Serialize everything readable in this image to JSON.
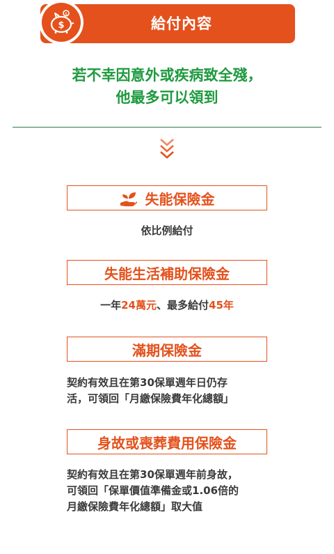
{
  "header": {
    "title": "給付內容",
    "icon": "piggy-bank-icon",
    "color": "#e4511c"
  },
  "headline": {
    "line1": "若不幸因意外或疾病致全殘，",
    "line2": "他最多可以領到",
    "color": "#1f9a3f"
  },
  "sections": [
    {
      "title": "失能保險金",
      "icon": "hand-leaf-icon",
      "desc": "依比例給付"
    },
    {
      "title": "失能生活補助保險金",
      "desc_parts": [
        "一年",
        "24萬元",
        "、最多給付",
        "45年"
      ]
    },
    {
      "title": "滿期保險金",
      "desc_lines": [
        "契約有效且在第30保單週年日仍存",
        "活，可領回「月繳保險費年化總額」"
      ]
    },
    {
      "title": "身故或喪葬費用保險金",
      "desc_lines": [
        "契約有效且在第30保單週年前身故，",
        "可領回「保單價值準備金或1.06倍的",
        "月繳保險費年化總額」取大值"
      ]
    }
  ]
}
